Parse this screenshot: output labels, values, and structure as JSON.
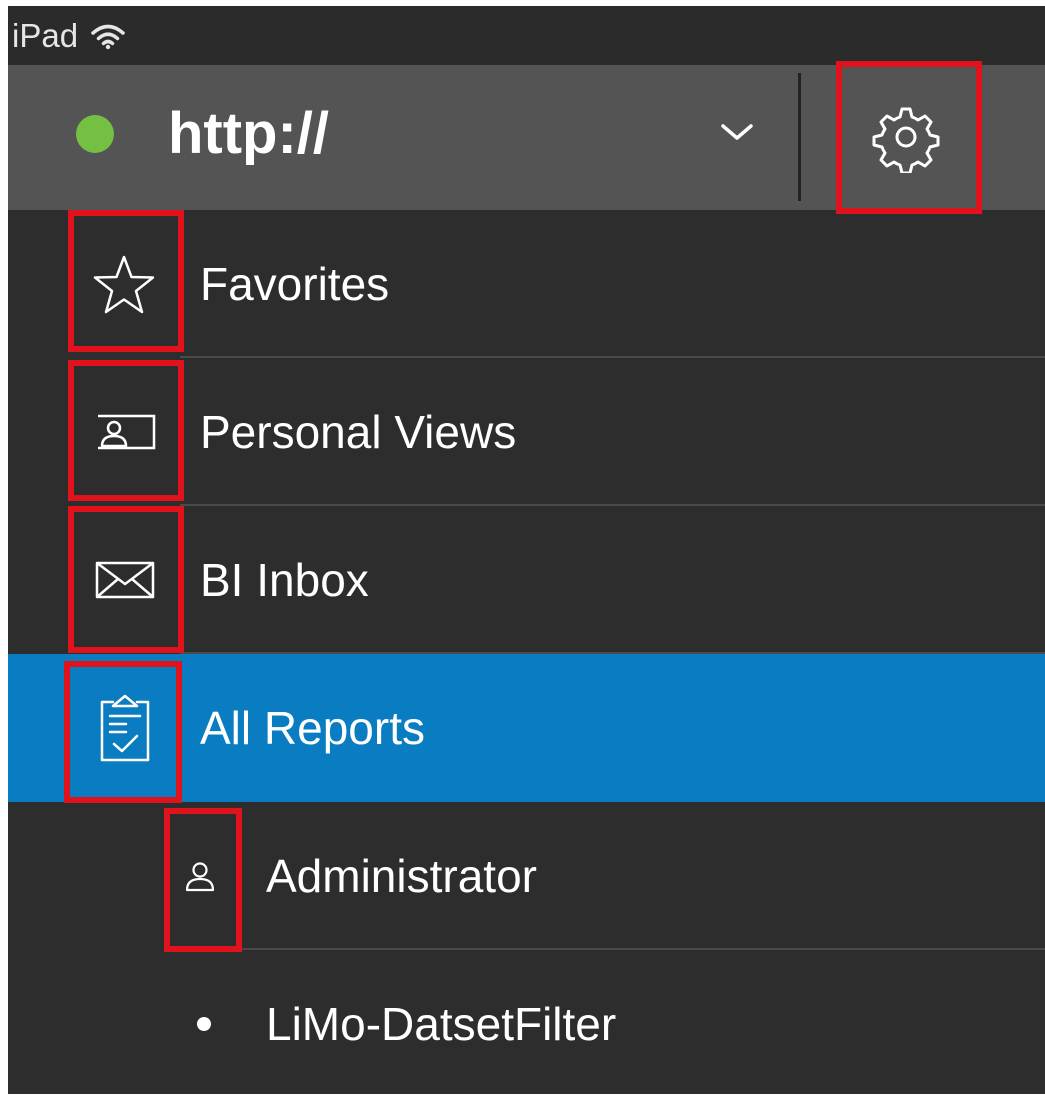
{
  "status_bar": {
    "device": "iPad",
    "wifi_icon": "wifi-icon"
  },
  "header": {
    "connection_status_color": "#74c043",
    "server_url": "http://",
    "dropdown_icon": "chevron-down-icon",
    "settings_icon": "gear-icon"
  },
  "nav": {
    "items": [
      {
        "label": "Favorites",
        "icon": "star-icon"
      },
      {
        "label": "Personal Views",
        "icon": "personal-views-icon"
      },
      {
        "label": "BI Inbox",
        "icon": "envelope-icon"
      },
      {
        "label": "All Reports",
        "icon": "clipboard-check-icon",
        "selected": true
      }
    ],
    "sub_items": [
      {
        "label": "Administrator",
        "icon": "user-icon"
      },
      {
        "label": "LiMo-DatsetFilter",
        "icon": "bullet-icon"
      }
    ]
  },
  "colors": {
    "selected_row": "#0a7dc2",
    "highlight": "#e0121b",
    "background": "#2d2d2d",
    "header": "#545454"
  }
}
